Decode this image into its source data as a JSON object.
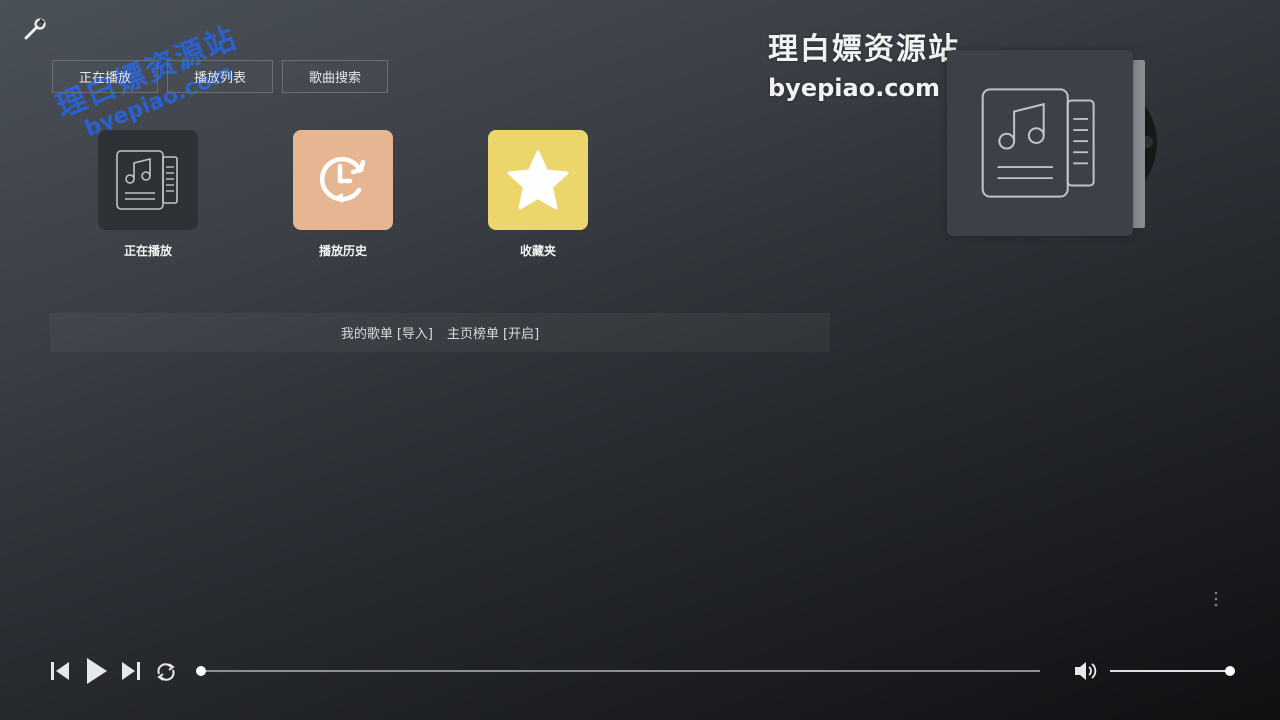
{
  "tabs": [
    {
      "label": "正在播放"
    },
    {
      "label": "播放列表"
    },
    {
      "label": "歌曲搜索"
    }
  ],
  "tiles": [
    {
      "label": "正在播放",
      "icon": "music-note-icon",
      "color": "#2e3136"
    },
    {
      "label": "播放历史",
      "icon": "history-icon",
      "color": "#e6b591"
    },
    {
      "label": "收藏夹",
      "icon": "star-icon",
      "color": "#ecd56a"
    }
  ],
  "playlist_bar": {
    "my_playlist": "我的歌单",
    "import": "[导入]",
    "home_chart": "主页榜单",
    "open": "[开启]"
  },
  "watermark": {
    "cn": "理白嫖资源站",
    "en": "byepiao.com"
  },
  "player": {
    "progress": 0.0,
    "volume": 1.0
  }
}
